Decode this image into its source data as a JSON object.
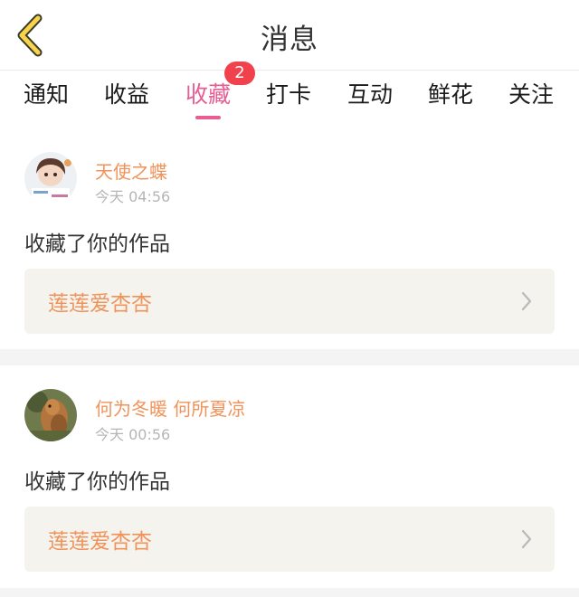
{
  "header": {
    "title": "消息"
  },
  "tabs": [
    {
      "label": "通知"
    },
    {
      "label": "收益"
    },
    {
      "label": "收藏",
      "badge": "2",
      "active": true
    },
    {
      "label": "打卡"
    },
    {
      "label": "互动"
    },
    {
      "label": "鲜花"
    },
    {
      "label": "关注"
    }
  ],
  "notifications": [
    {
      "username": "天使之蝶",
      "time": "今天 04:56",
      "action": "收藏了你的作品",
      "work_title": "莲莲爱杏杏"
    },
    {
      "username": "何为冬暖 何所夏凉",
      "time": "今天 00:56",
      "action": "收藏了你的作品",
      "work_title": "莲莲爱杏杏"
    }
  ],
  "colors": {
    "accent": "#e85d92",
    "badge": "#f0414c",
    "username": "#f0935a",
    "card_bg": "#f4f3ee"
  }
}
